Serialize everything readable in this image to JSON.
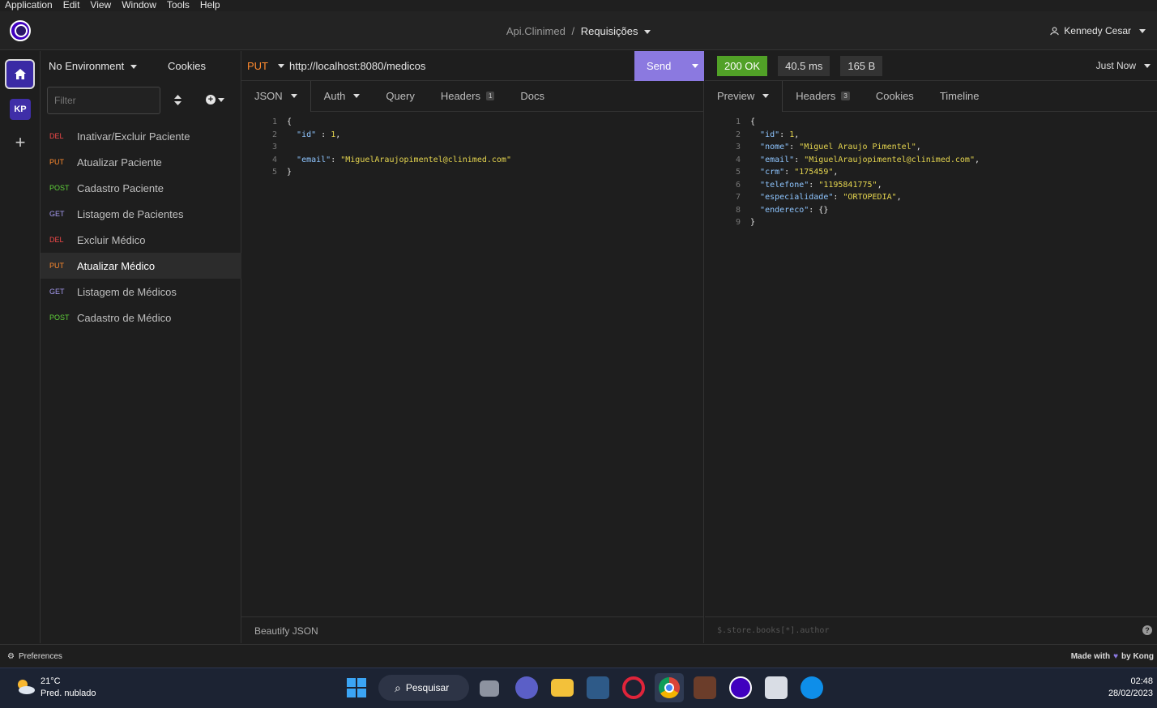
{
  "menu": [
    "Application",
    "Edit",
    "View",
    "Window",
    "Tools",
    "Help"
  ],
  "breadcrumb": {
    "project": "Api.Clinimed",
    "separator": "/",
    "current": "Requisições"
  },
  "user": "Kennedy Cesar",
  "rail": {
    "workspace_badge": "KP",
    "add": "+"
  },
  "sidebar": {
    "environment": "No Environment",
    "cookies": "Cookies",
    "filter_placeholder": "Filter",
    "requests": [
      {
        "method": "DEL",
        "name": "Inativar/Excluir Paciente",
        "color": "#f14949"
      },
      {
        "method": "PUT",
        "name": "Atualizar Paciente",
        "color": "#ff8a2e"
      },
      {
        "method": "POST",
        "name": "Cadastro Paciente",
        "color": "#5fcf3a"
      },
      {
        "method": "GET",
        "name": "Listagem de Pacientes",
        "color": "#a59af0"
      },
      {
        "method": "DEL",
        "name": "Excluir Médico",
        "color": "#f14949"
      },
      {
        "method": "PUT",
        "name": "Atualizar Médico",
        "color": "#ff8a2e"
      },
      {
        "method": "GET",
        "name": "Listagem de Médicos",
        "color": "#a59af0"
      },
      {
        "method": "POST",
        "name": "Cadastro de Médico",
        "color": "#5fcf3a"
      }
    ]
  },
  "request": {
    "method": "PUT",
    "url": "http://localhost:8080/medicos",
    "send": "Send",
    "tabs": {
      "body": "JSON",
      "auth": "Auth",
      "query": "Query",
      "headers": "Headers",
      "headers_count": "1",
      "docs": "Docs"
    },
    "body_lines": [
      "1",
      "2",
      "3",
      "4",
      "5"
    ],
    "beautify": "Beautify JSON"
  },
  "response": {
    "status": "200 OK",
    "time": "40.5 ms",
    "size": "165 B",
    "when": "Just Now",
    "tabs": {
      "preview": "Preview",
      "headers": "Headers",
      "headers_count": "3",
      "cookies": "Cookies",
      "timeline": "Timeline"
    },
    "body_lines": [
      "1",
      "2",
      "3",
      "4",
      "5",
      "6",
      "7",
      "8",
      "9"
    ],
    "filter_placeholder": "$.store.books[*].author",
    "help": "?"
  },
  "footer": {
    "preferences": "Preferences",
    "made_with": "Made with",
    "by": "by Kong"
  },
  "taskbar": {
    "temp": "21°C",
    "weather": "Pred. nublado",
    "search": "Pesquisar",
    "time": "02:48",
    "date": "28/02/2023"
  }
}
